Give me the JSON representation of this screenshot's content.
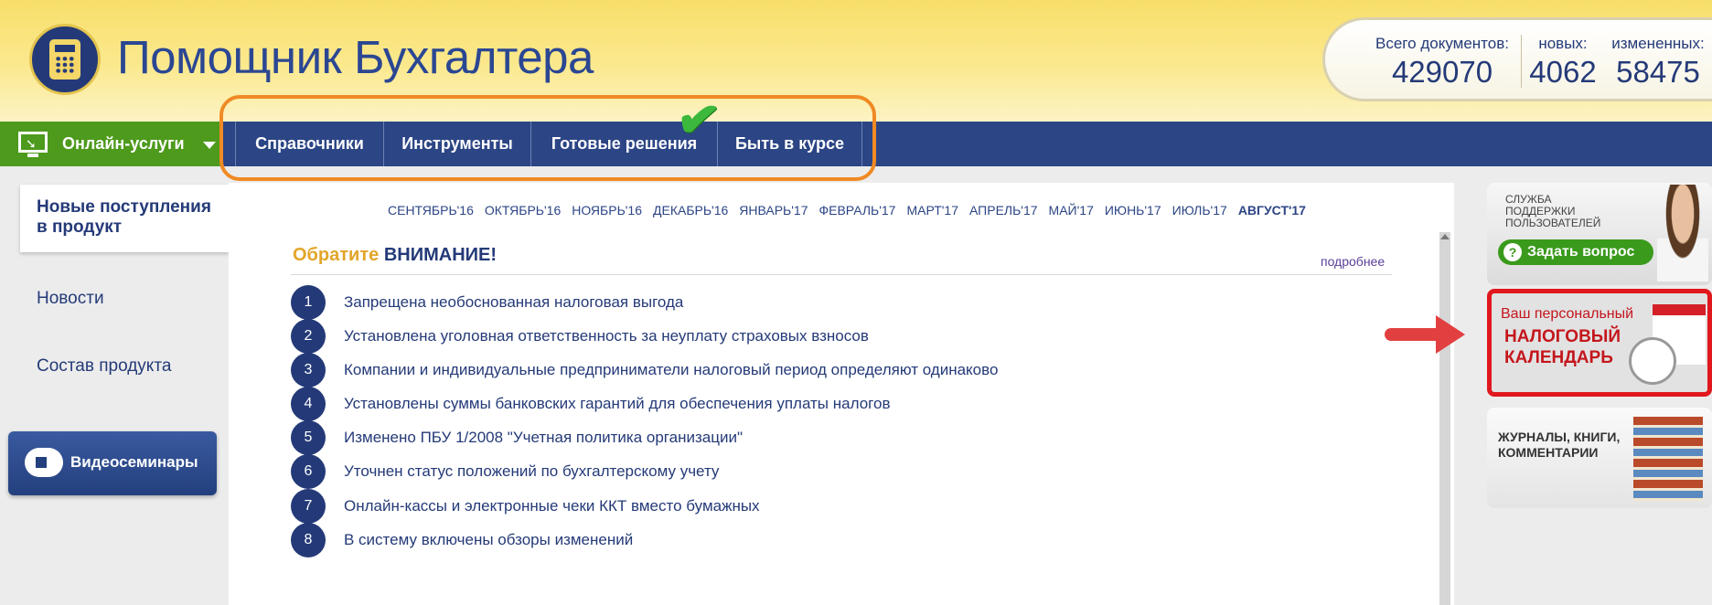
{
  "header": {
    "brand": "Помощник Бухгалтера",
    "stats": {
      "total_label": "Всего документов:",
      "total_value": "429070",
      "new_label": "новых:",
      "new_value": "4062",
      "modified_label": "измененных:",
      "modified_value": "58475"
    }
  },
  "nav": {
    "online_label": "Онлайн-услуги",
    "items": [
      "Справочники",
      "Инструменты",
      "Готовые решения",
      "Быть в курсе"
    ]
  },
  "sidebar": {
    "active_label": "Новые поступления в продукт",
    "items": [
      "Новости",
      "Состав продукта"
    ],
    "video_label": "Видеосеминары"
  },
  "main": {
    "months": [
      "СЕНТЯБРЬ'16",
      "ОКТЯБРЬ'16",
      "НОЯБРЬ'16",
      "ДЕКАБРЬ'16",
      "ЯНВАРЬ'17",
      "ФЕВРАЛЬ'17",
      "МАРТ'17",
      "АПРЕЛЬ'17",
      "МАЙ'17",
      "ИЮНЬ'17",
      "ИЮЛЬ'17",
      "АВГУСТ'17"
    ],
    "attention_prefix": "Обратите",
    "attention_word": "ВНИМАНИЕ!",
    "more_link": "подробнее",
    "items": [
      {
        "n": "1",
        "text": "Запрещена необоснованная налоговая выгода"
      },
      {
        "n": "2",
        "text": "Установлена уголовная ответственность за неуплату страховых взносов"
      },
      {
        "n": "3",
        "text": "Компании и индивидуальные предприниматели налоговый период определяют одинаково"
      },
      {
        "n": "4",
        "text": "Установлены суммы банковских гарантий для обеспечения уплаты налогов"
      },
      {
        "n": "5",
        "text": "Изменено ПБУ 1/2008 \"Учетная политика организации\""
      },
      {
        "n": "6",
        "text": "Уточнен статус положений по бухгалтерскому учету"
      },
      {
        "n": "7",
        "text": "Онлайн-кассы и электронные чеки ККТ вместо бумажных"
      },
      {
        "n": "8",
        "text": "В систему включены обзоры изменений"
      }
    ]
  },
  "right": {
    "support_service": "СЛУЖБА ПОДДЕРЖКИ ПОЛЬЗОВАТЕЛЕЙ",
    "support_button": "Задать вопрос",
    "calendar_line1": "Ваш персональный",
    "calendar_line2": "НАЛОГОВЫЙ КАЛЕНДАРЬ",
    "books": "ЖУРНАЛЫ, КНИГИ, КОММЕНТАРИИ"
  },
  "colors": {
    "brand": "#2b4793",
    "nav": "#2c4585",
    "online": "#4d9a1c",
    "highlight_orange": "#f08a24",
    "highlight_red": "#e0181e"
  }
}
